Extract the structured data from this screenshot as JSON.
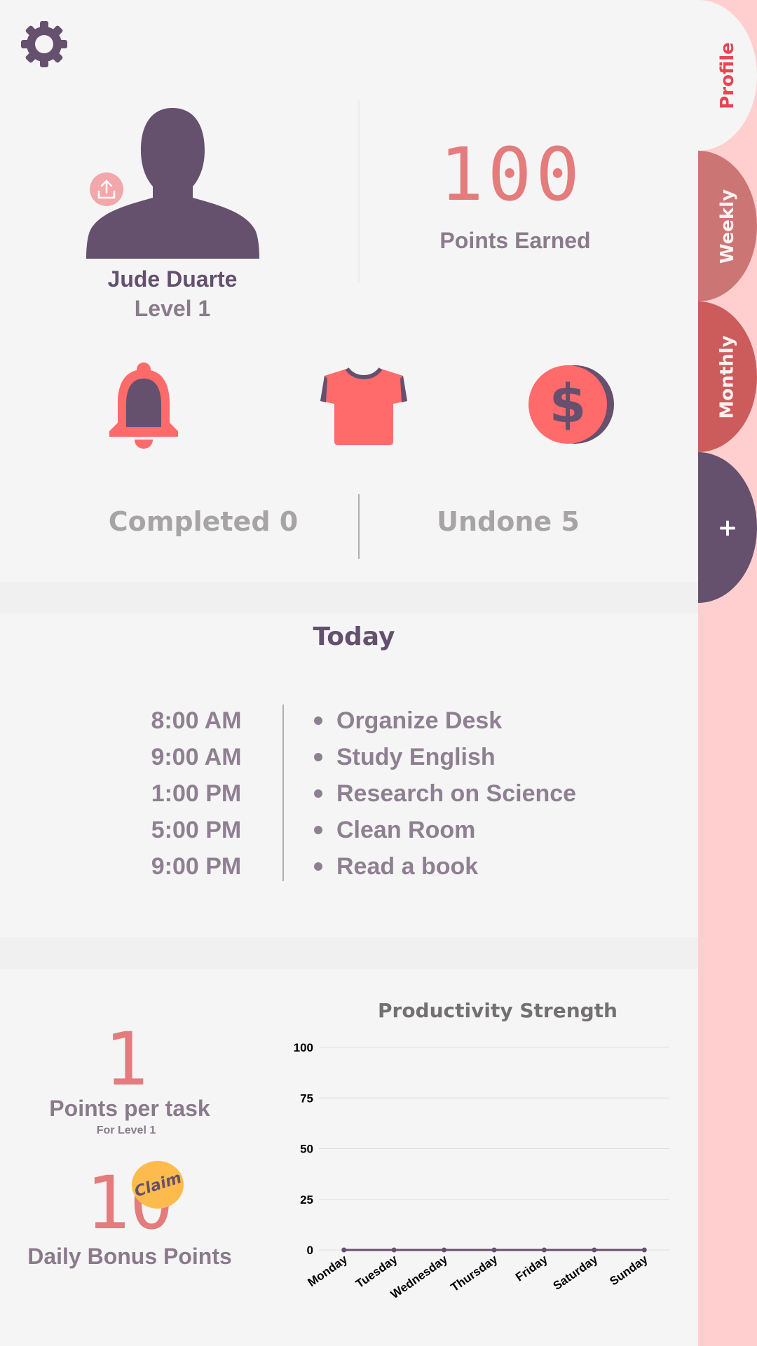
{
  "tabs": {
    "profile": "Profile",
    "weekly": "Weekly",
    "monthly": "Monthly",
    "add": "+"
  },
  "profile": {
    "name": "Jude Duarte",
    "level": "Level 1",
    "points_value": "100",
    "points_label": "Points Earned"
  },
  "icons": {
    "settings": "gear-icon",
    "upload": "upload-icon",
    "bell": "bell-icon",
    "shirt": "shirt-icon",
    "coin": "coin-icon"
  },
  "stats": {
    "completed": "Completed  0",
    "undone": "Undone 5"
  },
  "today": {
    "title": "Today",
    "schedule": [
      {
        "time": "8:00 AM",
        "task": "Organize Desk"
      },
      {
        "time": "9:00 AM",
        "task": "Study English"
      },
      {
        "time": "1:00 PM",
        "task": "Research on Science"
      },
      {
        "time": "5:00 PM",
        "task": "Clean Room"
      },
      {
        "time": "9:00 PM",
        "task": "Read a book"
      }
    ]
  },
  "points": {
    "per_task_value": "1",
    "per_task_label": "Points per task",
    "per_task_sub": "For Level 1",
    "bonus_value": "10",
    "bonus_label": "Daily Bonus Points",
    "claim_label": "Claim"
  },
  "colors": {
    "accent_purple": "#65506e",
    "accent_coral": "#e47b7c",
    "icon_red": "#ff6b6b",
    "claim_yellow": "#fdbb4d"
  },
  "chart_data": {
    "type": "line",
    "title": "Productivity Strength",
    "categories": [
      "Monday",
      "Tuesday",
      "Wednesday",
      "Thursday",
      "Friday",
      "Saturday",
      "Sunday"
    ],
    "series": [
      {
        "values": [
          0,
          0,
          0,
          0,
          0,
          0,
          0
        ]
      }
    ],
    "yticks": [
      100,
      75,
      50,
      25,
      0
    ],
    "ylim": [
      0,
      100
    ],
    "grid": true,
    "xlabel": "",
    "ylabel": ""
  }
}
